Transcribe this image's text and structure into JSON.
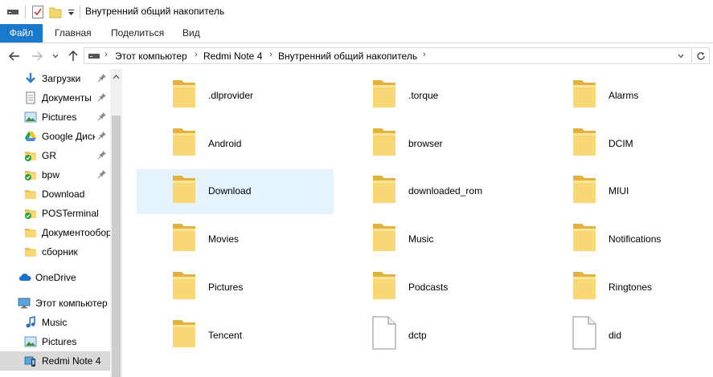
{
  "window": {
    "title": "Внутренний общий накопитель"
  },
  "ribbon": {
    "tabs": [
      "Файл",
      "Главная",
      "Поделиться",
      "Вид"
    ]
  },
  "address": {
    "crumbs": [
      "Этот компьютер",
      "Redmi Note 4",
      "Внутренний общий накопитель"
    ]
  },
  "sidebar": {
    "items": [
      {
        "label": "Загрузки",
        "icon": "download-arrow-icon",
        "pinned": true
      },
      {
        "label": "Документы",
        "icon": "documents-icon",
        "pinned": true
      },
      {
        "label": "Pictures",
        "icon": "pictures-icon",
        "pinned": true
      },
      {
        "label": "Google Диск",
        "icon": "google-drive-icon",
        "pinned": true
      },
      {
        "label": "GR",
        "icon": "synced-folder-icon",
        "pinned": true
      },
      {
        "label": "bpw",
        "icon": "synced-folder-icon",
        "pinned": true
      },
      {
        "label": "Download",
        "icon": "folder-icon",
        "pinned": false
      },
      {
        "label": "POSTerminal",
        "icon": "synced-folder-icon",
        "pinned": false
      },
      {
        "label": "Документооборот",
        "icon": "folder-icon",
        "pinned": false
      },
      {
        "label": "сборник",
        "icon": "folder-icon",
        "pinned": false
      },
      {
        "label": "OneDrive",
        "icon": "onedrive-icon",
        "pinned": false
      },
      {
        "label": "Этот компьютер",
        "icon": "computer-icon",
        "pinned": false
      },
      {
        "label": "Music",
        "icon": "music-icon",
        "pinned": false
      },
      {
        "label": "Pictures",
        "icon": "pictures-icon",
        "pinned": false
      },
      {
        "label": "Redmi Note 4",
        "icon": "phone-icon",
        "pinned": false,
        "selected": true
      }
    ]
  },
  "files": [
    {
      "name": ".dlprovider",
      "type": "folder"
    },
    {
      "name": ".torque",
      "type": "folder"
    },
    {
      "name": "Alarms",
      "type": "folder"
    },
    {
      "name": "Android",
      "type": "folder"
    },
    {
      "name": "browser",
      "type": "folder"
    },
    {
      "name": "DCIM",
      "type": "folder"
    },
    {
      "name": "Download",
      "type": "folder",
      "selected": true
    },
    {
      "name": "downloaded_rom",
      "type": "folder"
    },
    {
      "name": "MIUI",
      "type": "folder"
    },
    {
      "name": "Movies",
      "type": "folder"
    },
    {
      "name": "Music",
      "type": "folder"
    },
    {
      "name": "Notifications",
      "type": "folder"
    },
    {
      "name": "Pictures",
      "type": "folder"
    },
    {
      "name": "Podcasts",
      "type": "folder"
    },
    {
      "name": "Ringtones",
      "type": "folder"
    },
    {
      "name": "Tencent",
      "type": "folder"
    },
    {
      "name": "dctp",
      "type": "file"
    },
    {
      "name": "did",
      "type": "file"
    }
  ],
  "colors": {
    "accent": "#1979ca",
    "selection": "#e5f3ff",
    "folder": "#f5d66a"
  }
}
